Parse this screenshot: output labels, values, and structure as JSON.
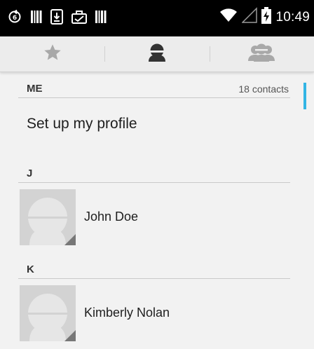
{
  "status_bar": {
    "time": "10:49",
    "left_icons": [
      "sync-icon",
      "barcode-icon",
      "download-icon",
      "briefcase-icon",
      "barcode-icon"
    ],
    "right_icons": [
      "wifi-icon",
      "signal-icon",
      "battery-charging-icon"
    ]
  },
  "tabs": [
    {
      "name": "favorites",
      "icon": "star-icon",
      "selected": false
    },
    {
      "name": "contacts",
      "icon": "person-icon",
      "selected": true
    },
    {
      "name": "groups",
      "icon": "group-icon",
      "selected": false
    }
  ],
  "me_section": {
    "title": "ME",
    "count": "18 contacts",
    "profile_label": "Set up my profile"
  },
  "sections": [
    {
      "letter": "J",
      "contacts": [
        {
          "name": "John Doe"
        }
      ]
    },
    {
      "letter": "K",
      "contacts": [
        {
          "name": "Kimberly Nolan"
        }
      ]
    }
  ],
  "colors": {
    "accent": "#33b5e5",
    "background": "#f2f2f2",
    "status_bar": "#000000"
  }
}
